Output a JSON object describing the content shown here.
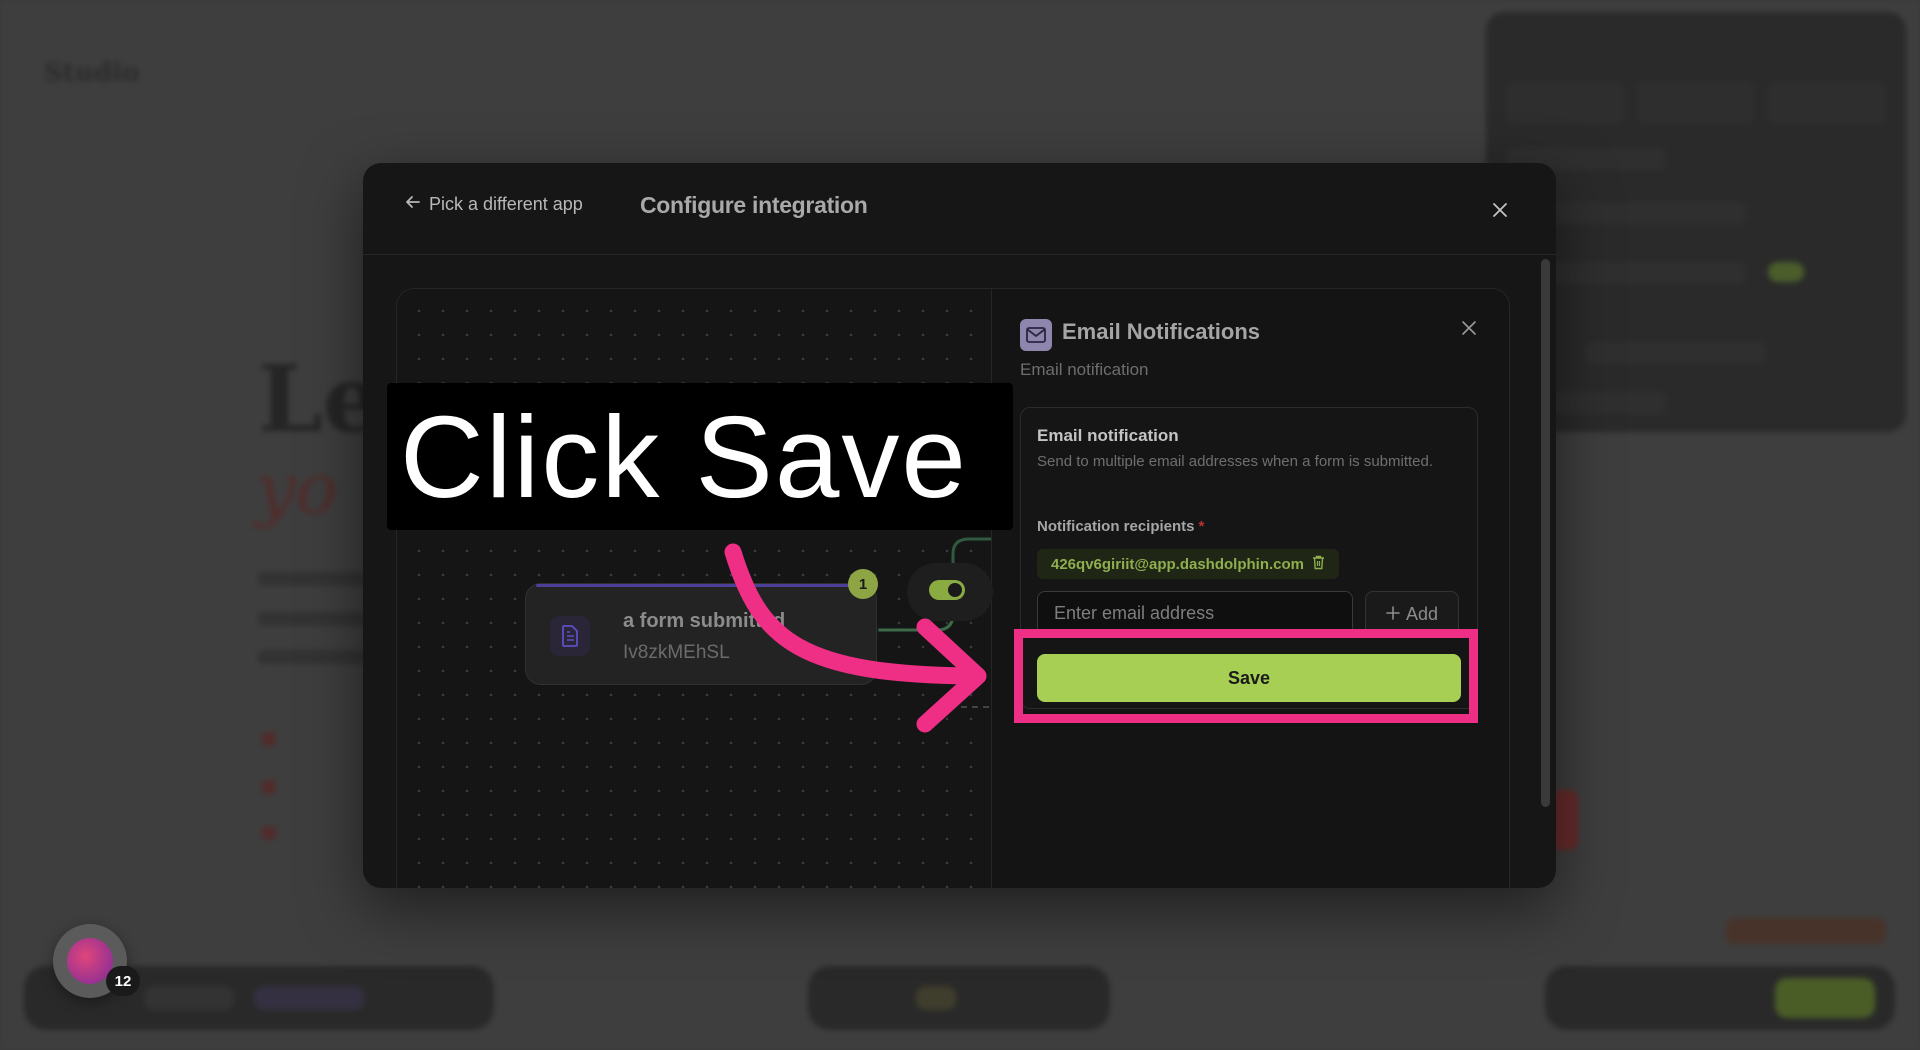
{
  "background": {
    "app_logo": "Studio"
  },
  "avatar": {
    "badge_count": "12"
  },
  "modal": {
    "back_label": "Pick a different app",
    "title": "Configure integration"
  },
  "canvas": {
    "node_title": "a form submitted",
    "node_id": "Iv8zkMEhSL",
    "step_number": "1"
  },
  "panel": {
    "title": "Email Notifications",
    "subtitle": "Email notification",
    "card_heading": "Email notification",
    "card_description": "Send to multiple email addresses when a form is submitted.",
    "recipients_label": "Notification recipients",
    "required_marker": "*",
    "recipient_email": "426qv6giriit@app.dashdolphin.com",
    "email_placeholder": "Enter email address",
    "add_label": "Add",
    "save_label": "Save"
  },
  "tutorial": {
    "instruction": "Click Save"
  },
  "colors": {
    "accent_green": "#a6cf53",
    "highlight_pink": "#ef2f86"
  }
}
